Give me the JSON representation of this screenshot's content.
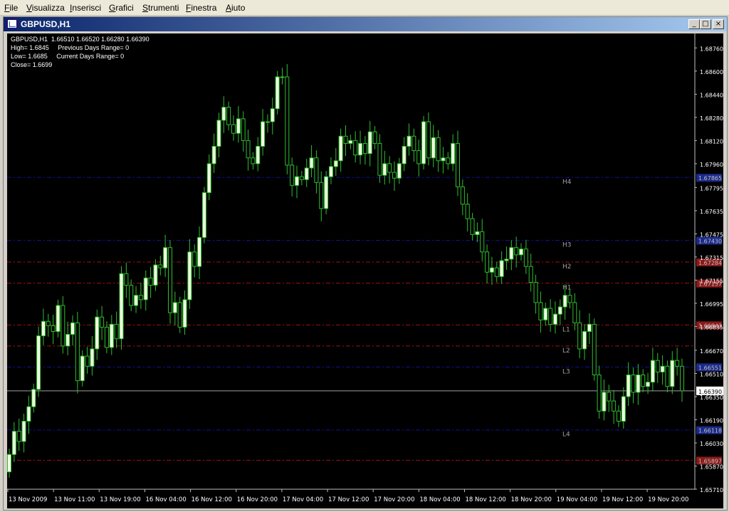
{
  "menu": {
    "items": [
      "File",
      "Visualizza",
      "Inserisci",
      "Grafici",
      "Strumenti",
      "Finestra",
      "Aiuto"
    ]
  },
  "window": {
    "title": "GBPUSD,H1",
    "minimize_glyph": "_",
    "restore_glyph": "□",
    "close_glyph": "×"
  },
  "info": {
    "ohlc": "GBPUSD,H1  1.66510 1.66520 1.66280 1.66390",
    "high": "High= 1.6845     Previous Days Range= 0",
    "low": "Low= 1.6685     Current Days Range= 0",
    "close": "Close= 1.6699"
  },
  "chart_data": {
    "type": "candlestick",
    "symbol": "GBPUSD",
    "timeframe": "H1",
    "ylim": [
      1.6571,
      1.6886
    ],
    "y_ticks": [
      "1.68760",
      "1.68600",
      "1.68440",
      "1.68280",
      "1.68120",
      "1.67960",
      "1.67795",
      "1.67635",
      "1.67475",
      "1.67315",
      "1.67155",
      "1.66995",
      "1.66835",
      "1.66670",
      "1.66510",
      "1.66350",
      "1.66190",
      "1.66030",
      "1.65870",
      "1.65710"
    ],
    "x_ticks": [
      "13 Nov 2009",
      "13 Nov 11:00",
      "13 Nov 19:00",
      "16 Nov 04:00",
      "16 Nov 12:00",
      "16 Nov 20:00",
      "17 Nov 04:00",
      "17 Nov 12:00",
      "17 Nov 20:00",
      "18 Nov 04:00",
      "18 Nov 12:00",
      "18 Nov 20:00",
      "19 Nov 04:00",
      "19 Nov 12:00",
      "19 Nov 20:00"
    ],
    "current_price": "1.66390",
    "level_lines": [
      {
        "label": "H4",
        "price": 1.67865,
        "color": "#1010a0",
        "tag": "1.67865",
        "tag_bg": "#1a2a8a"
      },
      {
        "label": "H3",
        "price": 1.6743,
        "color": "#1010a0",
        "tag": "1.67430",
        "tag_bg": "#1a2a8a"
      },
      {
        "label": "H2",
        "price": 1.6728,
        "color": "#a01010",
        "tag": "1.67284",
        "tag_bg": "#8a1a1a"
      },
      {
        "label": "H1",
        "price": 1.67134,
        "color": "#a01010",
        "tag": "1.67157",
        "tag_bg": "#8a1a1a"
      },
      {
        "label": "L1",
        "price": 1.66845,
        "color": "#a01010",
        "tag": "1.66843",
        "tag_bg": "#8a1a1a"
      },
      {
        "label": "L2",
        "price": 1.667,
        "color": "#a01010",
        "tag": "",
        "tag_bg": ""
      },
      {
        "label": "L3",
        "price": 1.66555,
        "color": "#1010a0",
        "tag": "1.66551",
        "tag_bg": "#1a2a8a"
      },
      {
        "label": "L4",
        "price": 1.6612,
        "color": "#1010a0",
        "tag": "1.66118",
        "tag_bg": "#1a2a8a"
      },
      {
        "label": "",
        "price": 1.6591,
        "color": "#a01010",
        "tag": "1.65897",
        "tag_bg": "#8a1a1a"
      }
    ],
    "candles_close": [
      1.6595,
      1.6611,
      1.6604,
      1.6618,
      1.6628,
      1.664,
      1.6677,
      1.6687,
      1.6684,
      1.668,
      1.6698,
      1.667,
      1.6678,
      1.6686,
      1.6646,
      1.6663,
      1.6656,
      1.6668,
      1.669,
      1.6683,
      1.6669,
      1.6685,
      1.6675,
      1.672,
      1.6712,
      1.6698,
      1.6705,
      1.6702,
      1.6717,
      1.6712,
      1.6726,
      1.6724,
      1.6738,
      1.6693,
      1.67,
      1.6683,
      1.6702,
      1.6735,
      1.6725,
      1.6745,
      1.6776,
      1.6796,
      1.6808,
      1.6826,
      1.6835,
      1.6823,
      1.6817,
      1.6827,
      1.6812,
      1.68,
      1.6796,
      1.6808,
      1.6825,
      1.6825,
      1.6834,
      1.6856,
      1.6856,
      1.6795,
      1.6781,
      1.6787,
      1.6785,
      1.6793,
      1.68,
      1.6783,
      1.6765,
      1.6787,
      1.6794,
      1.6798,
      1.6815,
      1.681,
      1.6812,
      1.6802,
      1.681,
      1.6803,
      1.6818,
      1.681,
      1.6788,
      1.6796,
      1.679,
      1.6786,
      1.6796,
      1.6808,
      1.6815,
      1.6805,
      1.6796,
      1.6825,
      1.68,
      1.6814,
      1.6798,
      1.68,
      1.6796,
      1.681,
      1.678,
      1.6768,
      1.6758,
      1.6747,
      1.6749,
      1.6735,
      1.6721,
      1.6724,
      1.6718,
      1.6729,
      1.673,
      1.6738,
      1.6733,
      1.6737,
      1.6725,
      1.6714,
      1.67,
      1.6688,
      1.6696,
      1.6685,
      1.6692,
      1.6697,
      1.6705,
      1.67,
      1.6686,
      1.6668,
      1.668,
      1.6685,
      1.665,
      1.6625,
      1.6638,
      1.6632,
      1.6625,
      1.6618,
      1.6635,
      1.665,
      1.6638,
      1.665,
      1.6642,
      1.6645,
      1.666,
      1.6652,
      1.6656,
      1.6642,
      1.666,
      1.6656,
      1.6639
    ]
  }
}
